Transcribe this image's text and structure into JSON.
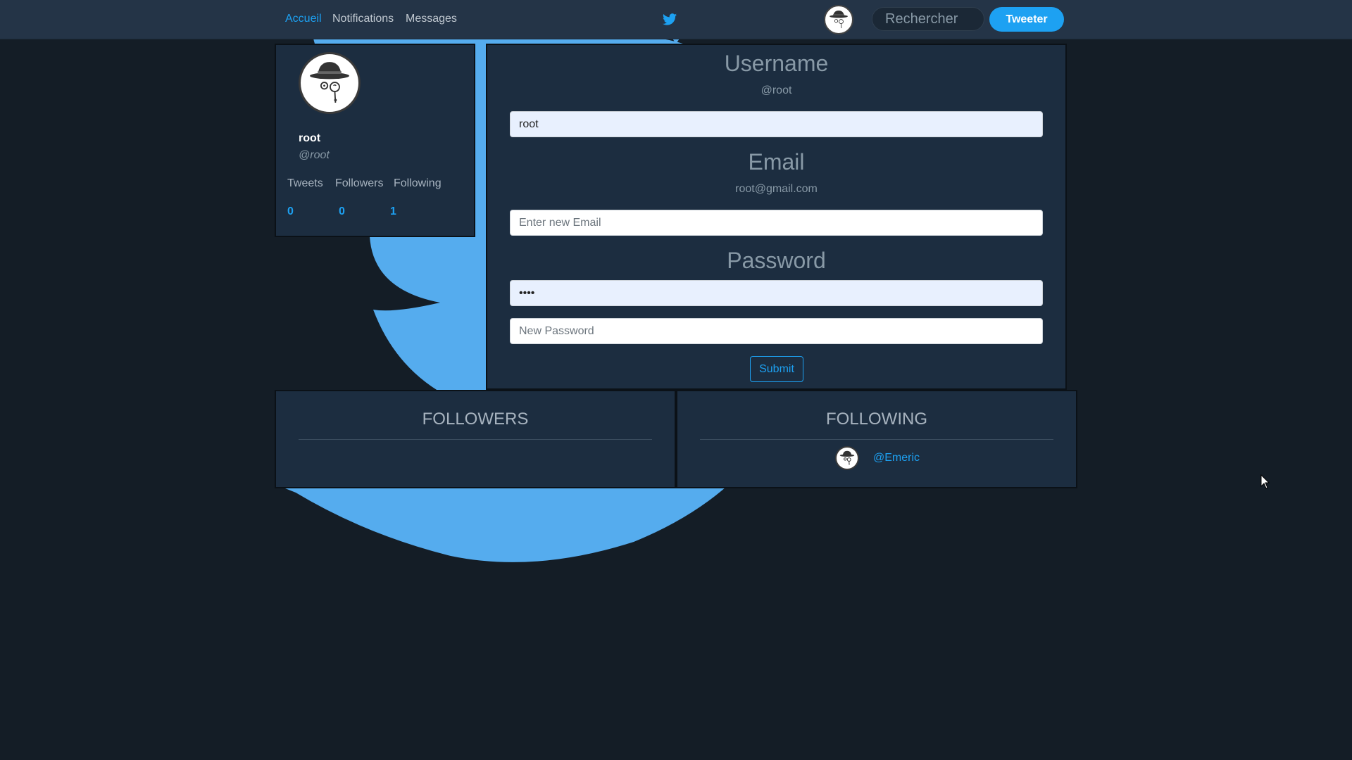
{
  "nav": {
    "home": "Accueil",
    "notifications": "Notifications",
    "messages": "Messages",
    "search_placeholder": "Rechercher",
    "tweet_button": "Tweeter"
  },
  "profile": {
    "name": "root",
    "handle": "@root",
    "stats": [
      {
        "label": "Tweets",
        "value": "0"
      },
      {
        "label": "Followers",
        "value": "0"
      },
      {
        "label": "Following",
        "value": "1"
      }
    ]
  },
  "settings": {
    "username_title": "Username",
    "username_current": "@root",
    "username_value": "root",
    "email_title": "Email",
    "email_current": "root@gmail.com",
    "email_placeholder": "Enter new Email",
    "password_title": "Password",
    "password_value": "root",
    "new_password_placeholder": "New Password",
    "submit_label": "Submit"
  },
  "followers": {
    "title": "FOLLOWERS",
    "items": []
  },
  "following": {
    "title": "FOLLOWING",
    "items": [
      {
        "handle": "@Emeric"
      }
    ]
  },
  "colors": {
    "accent": "#1da1f2",
    "background": "#141d26",
    "navbar": "#243447",
    "panel": "#1c2d40",
    "bird": "#55acee"
  }
}
